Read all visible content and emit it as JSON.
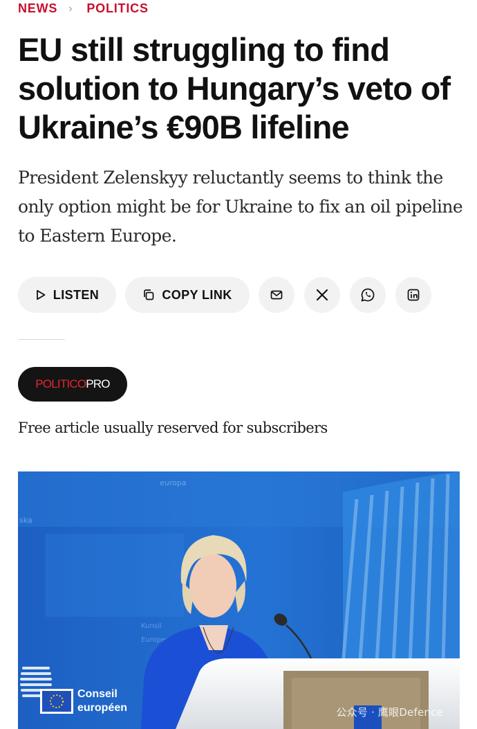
{
  "breadcrumb": {
    "section": "NEWS",
    "subsection": "POLITICS"
  },
  "headline": "EU still struggling to find solution to Hungary’s veto of Ukraine’s €90B lifeline",
  "dek": "President Zelenskyy reluctantly seems to think the only option might be for Ukraine to fix an oil pipeline to Eastern Europe.",
  "actions": {
    "listen_label": "LISTEN",
    "copy_link_label": "COPY LINK",
    "share_icons": [
      "mail-icon",
      "x-icon",
      "whatsapp-icon",
      "linkedin-icon"
    ]
  },
  "politico_pro": {
    "politico": "POLITICO",
    "pro": "PRO"
  },
  "subscriber_note": "Free article usually reserved for subscribers",
  "photo": {
    "council_logo_text_1": "Conseil",
    "council_logo_text_2": "européen",
    "background_sign_1": "europa",
    "background_sign_2": "Kunsil",
    "background_sign_3": "Europeo",
    "background_sign_4": "ska",
    "watermark": "公众号 · 鹰眼Defence"
  },
  "colors": {
    "accent": "#c8102e",
    "pill_bg": "#f2f2f2",
    "badge_bg": "#141414",
    "photo_blue": "#1e63c6"
  }
}
